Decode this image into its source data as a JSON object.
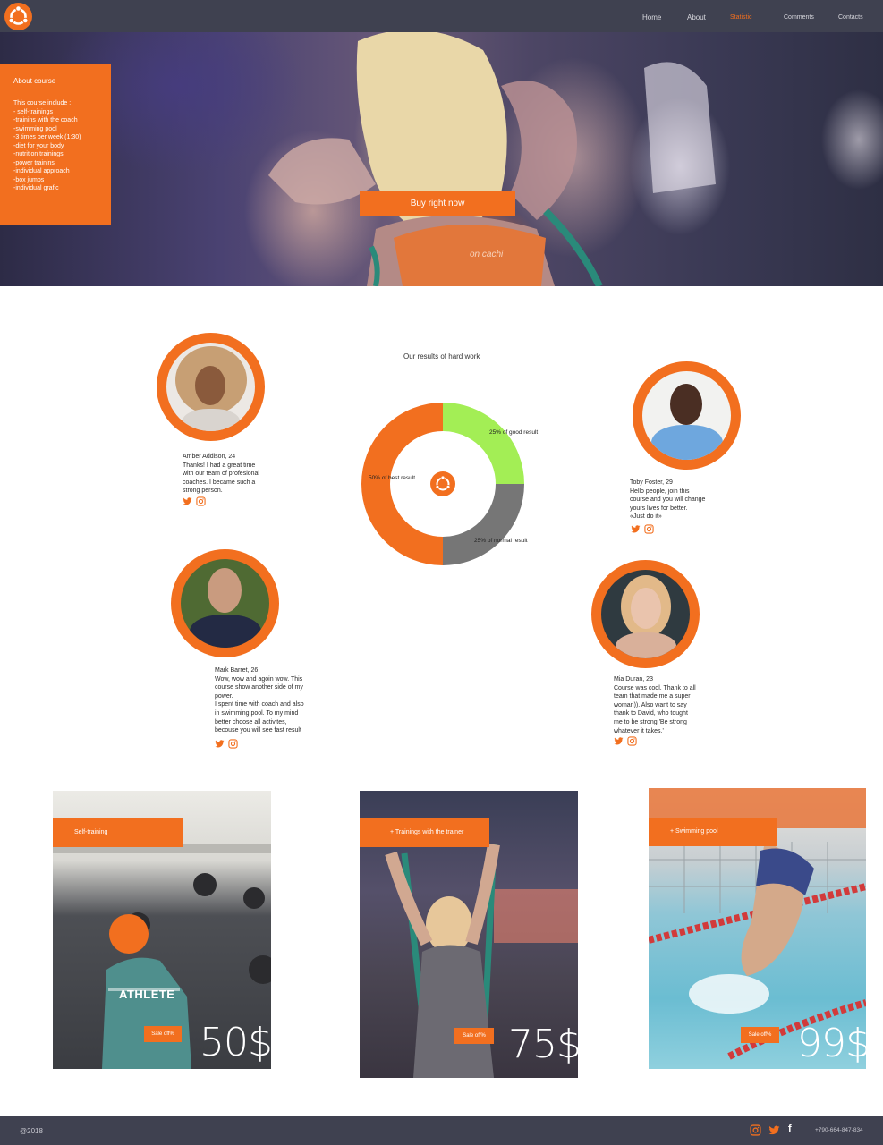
{
  "header": {
    "nav": [
      "Home",
      "About",
      "Statistic",
      "Comments",
      "Contacts"
    ],
    "active_nav": "Statistic"
  },
  "hero": {
    "about_title": "About course",
    "course_lines": [
      "This course include :",
      "- self-trainings",
      "-trainins with the coach",
      "-swimming pool",
      "-3 times per week (1:30)",
      "-diet for your body",
      "-nutrition trainings",
      "-power trainins",
      "-individual approach",
      "-box jumps",
      "-individual grafic"
    ],
    "shirt_logo_text": "on cachi",
    "buy_button": "Buy right now"
  },
  "testimonials": [
    {
      "name": "Amber Addison, 24",
      "text": "Thanks! I had a great time\nwith our team of profesional\ncoaches.  I became such a\nstrong person."
    },
    {
      "name": "Toby Foster, 29",
      "text": "Hello people, join this\ncourse and you will change\nyours lives for better.\n«Just do it»"
    },
    {
      "name": "Mark Barret, 26",
      "text": "Wow, wow and agoin wow. This\ncourse show another side of my\npower.\nI spent time with coach and also\nin swimming pool. To my mind\nbetter choose all activites,\nbecouse you will see fast result"
    },
    {
      "name": "Mia Duran, 23",
      "text": "Course was cool. Thank to all\nteam that made me a super\nwoman)). Also want to say\nthank to David, who tought\nme to be strong.'Be strong\nwhatever it takes.'"
    }
  ],
  "chart_data": {
    "type": "pie",
    "title": "Our results of hard work",
    "slices": [
      {
        "label": "25% of good result",
        "value": 25,
        "color": "#a3ee55"
      },
      {
        "label": "25% of normal result",
        "value": 25,
        "color": "#767676"
      },
      {
        "label": "50% of best result",
        "value": 50,
        "color": "#f26f1f"
      }
    ]
  },
  "cards": [
    {
      "tag": "Self-training",
      "sale": "Sale off%",
      "price": "50$"
    },
    {
      "tag": "+ Trainings with the trainer",
      "sale": "Sale off%",
      "price": "75$"
    },
    {
      "tag": "+ Swimming pool",
      "sale": "Sale off%",
      "price": "99$"
    }
  ],
  "footer": {
    "copyright": "@2018",
    "phone": "+790-664-847-834"
  },
  "colors": {
    "accent": "#f26f1f",
    "header_bg": "#3f4150",
    "good": "#a3ee55",
    "normal": "#767676"
  }
}
